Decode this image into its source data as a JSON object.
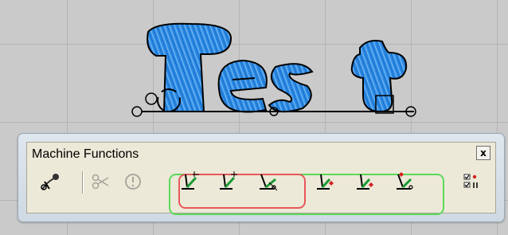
{
  "panel": {
    "title": "Machine Functions",
    "close_label": "x"
  },
  "design": {
    "text": "Test",
    "fill_color": "#2b8be6"
  },
  "toolbar": {
    "tools": [
      {
        "id": "thread-color",
        "icon": "needle-thread-icon"
      },
      {
        "id": "cut",
        "icon": "scissors-icon",
        "disabled": true
      },
      {
        "id": "stop",
        "icon": "stop-info-icon",
        "disabled": true
      },
      {
        "id": "needle-1",
        "icon": "needle-stitch-icon"
      },
      {
        "id": "needle-2",
        "icon": "needle-stitch-icon"
      },
      {
        "id": "needle-trim",
        "icon": "needle-trim-icon"
      },
      {
        "id": "needle-red-1",
        "icon": "needle-stitch-red-icon"
      },
      {
        "id": "needle-red-2",
        "icon": "needle-stitch-red-icon"
      },
      {
        "id": "needle-red-trim",
        "icon": "needle-trim-red-icon"
      },
      {
        "id": "checklist",
        "icon": "checklist-icon"
      }
    ]
  },
  "highlights": {
    "red": "#e8585a",
    "green": "#5cd95a"
  }
}
